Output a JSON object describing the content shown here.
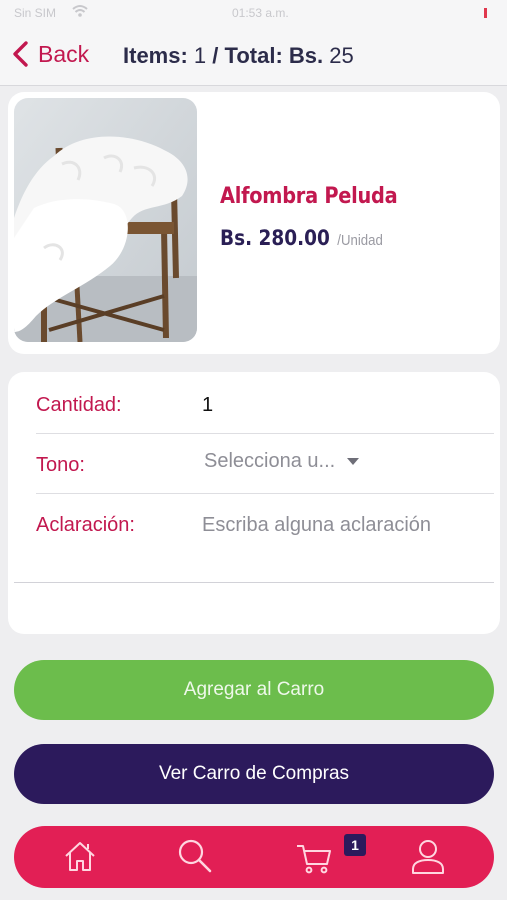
{
  "status_bar": {
    "carrier": "Sin SIM",
    "time": "01:53 a.m."
  },
  "nav": {
    "back_label": "Back",
    "items_label": "Items:",
    "items_count": "1",
    "total_label": "/ Total:",
    "currency": "Bs.",
    "total_value": "25"
  },
  "product": {
    "name": "Alfombra Peluda",
    "price": "Bs. 280.00",
    "unit": "/Unidad",
    "image": "white-fur-rug-on-wooden-chair"
  },
  "form": {
    "quantity_label": "Cantidad:",
    "quantity_value": "1",
    "tone_label": "Tono:",
    "tone_value": "Selecciona u...",
    "note_label": "Aclaración:",
    "note_placeholder": "Escriba alguna aclaración",
    "note_value": ""
  },
  "buttons": {
    "add_to_cart": "Agregar al Carro",
    "view_cart": "Ver Carro de Compras"
  },
  "tab_bar": {
    "items": [
      "home-icon",
      "search-icon",
      "cart-icon",
      "profile-icon"
    ],
    "cart_badge": "1"
  },
  "colors": {
    "accent": "#c2184f",
    "tab_bar": "#e21f55",
    "primary_dark": "#2c1a5c",
    "success": "#6cbd4c",
    "price": "#2a1f55"
  }
}
